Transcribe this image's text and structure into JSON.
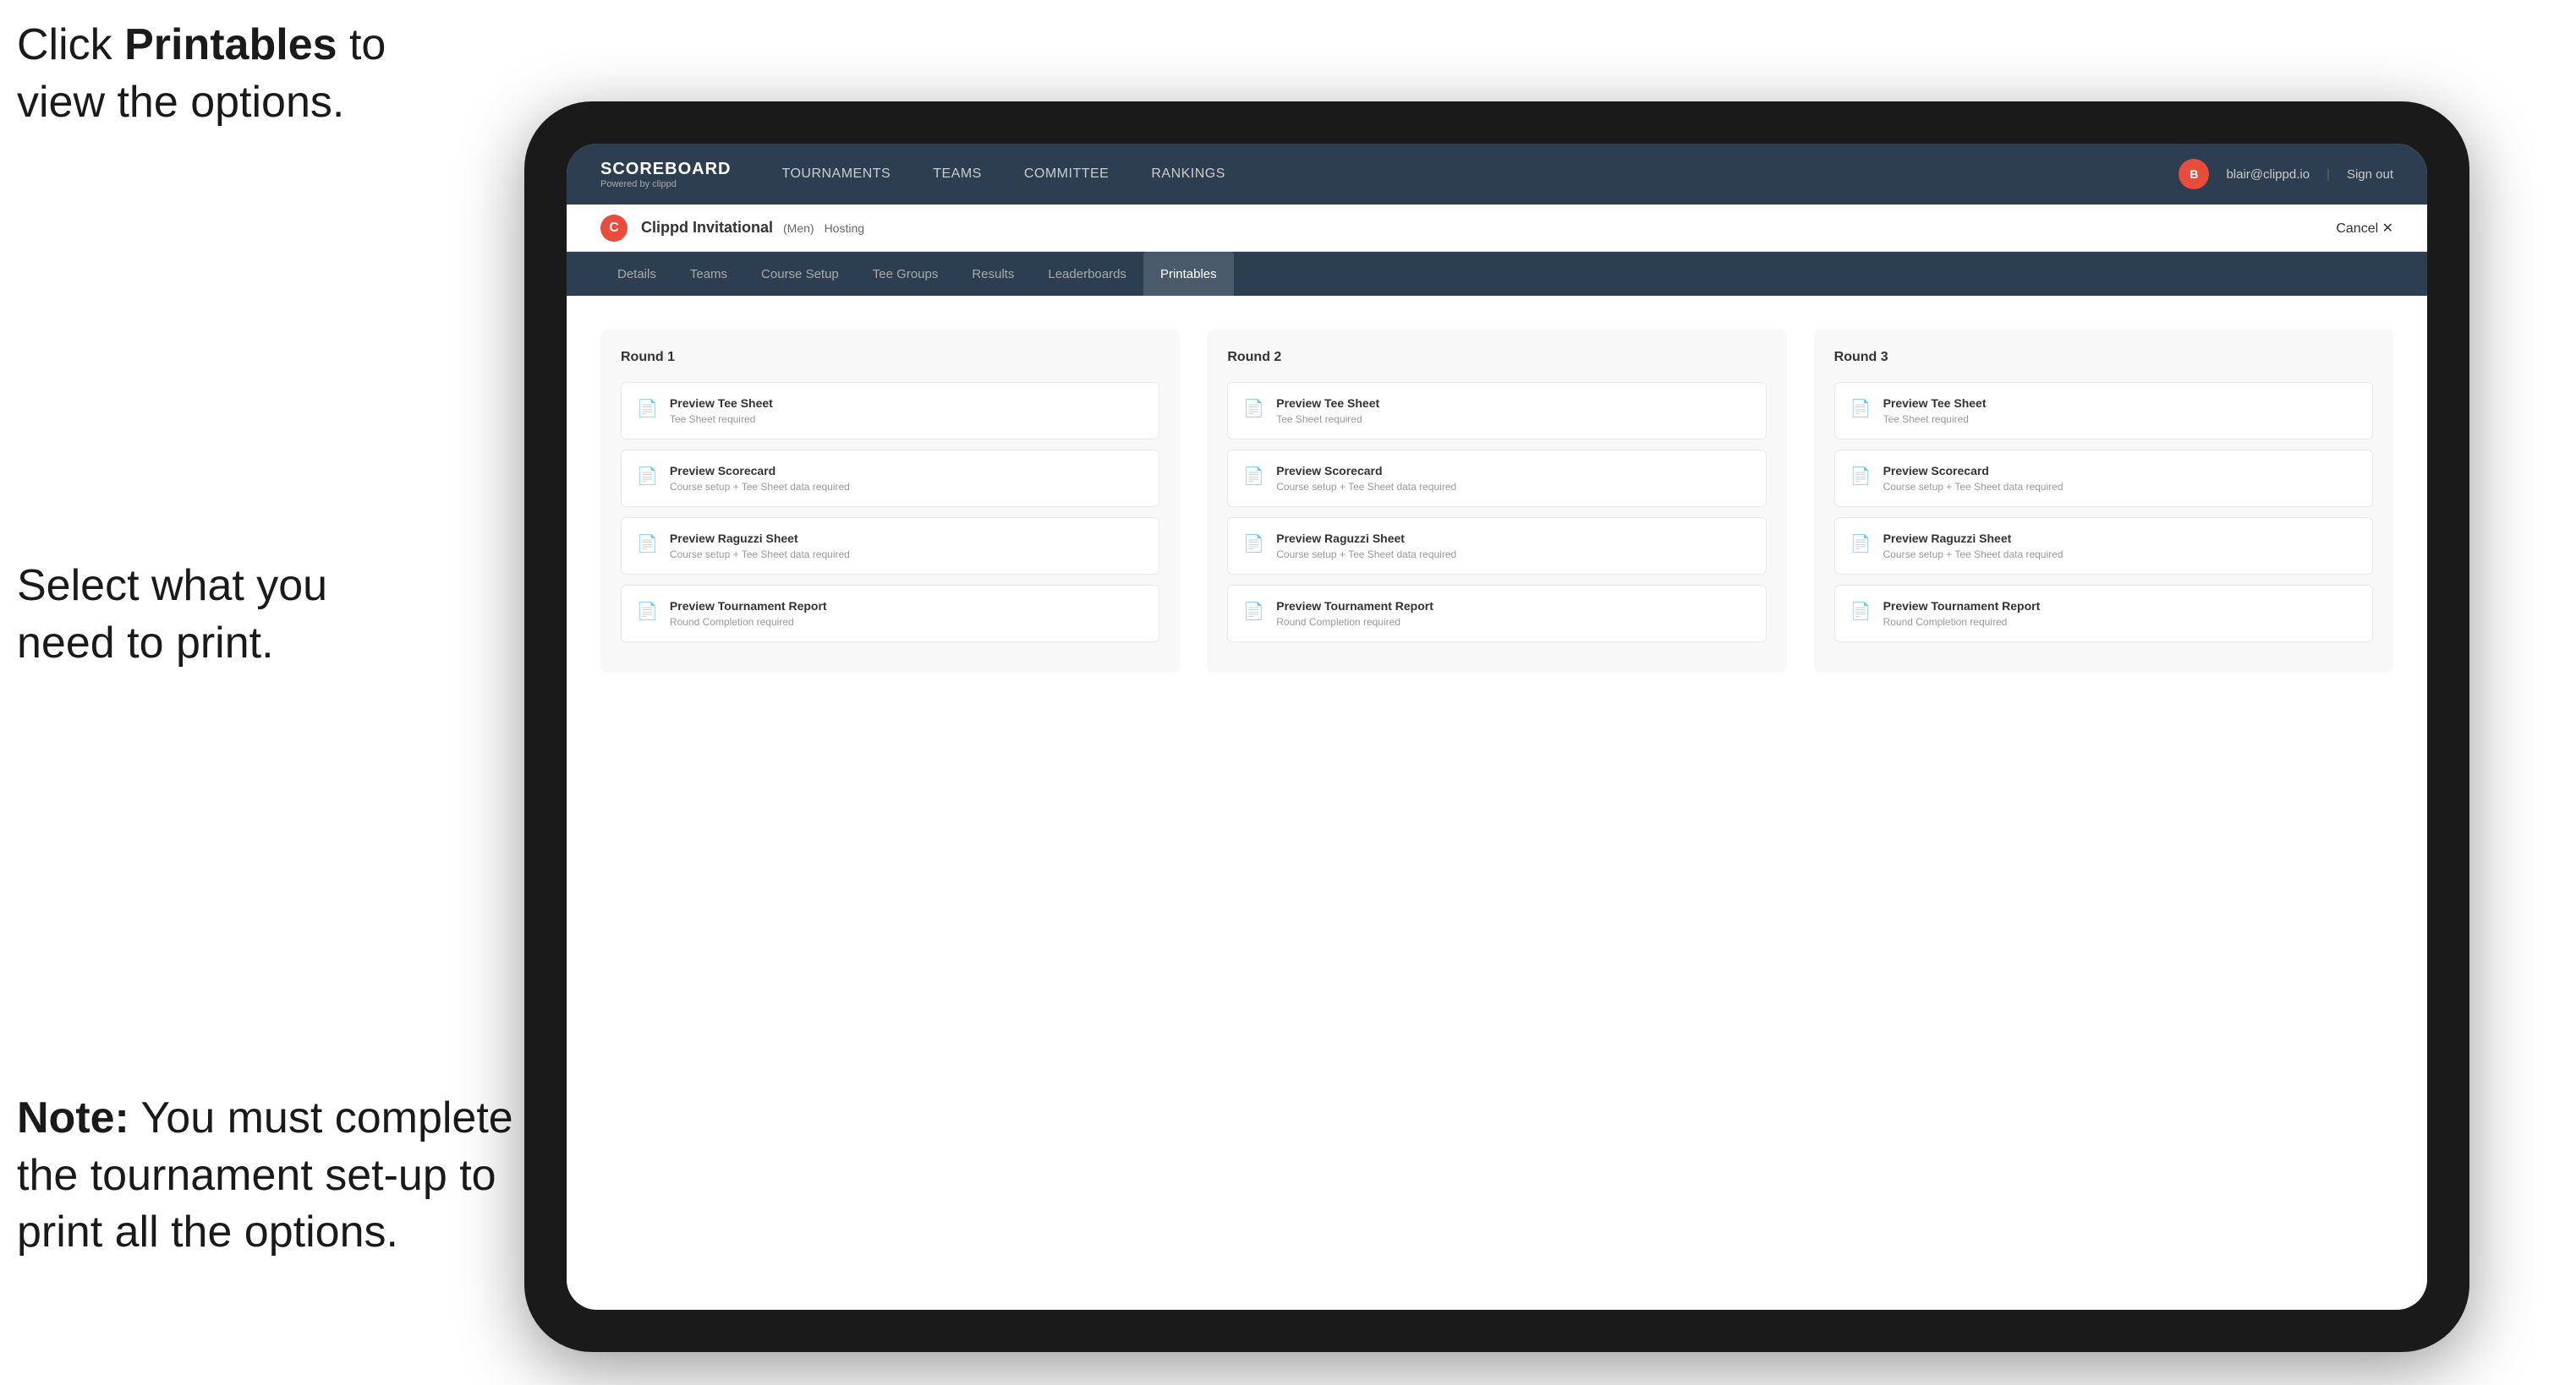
{
  "instructions": {
    "top_line1": "Click ",
    "top_bold": "Printables",
    "top_line2": " to",
    "top_line3": "view the options.",
    "middle": "Select what you\nneed to print.",
    "bottom_bold": "Note:",
    "bottom_text": " You must\ncomplete the\ntournament set-up\nto print all the options."
  },
  "header": {
    "brand_title": "SCOREBOARD",
    "brand_sub": "Powered by clippd",
    "nav_items": [
      {
        "label": "TOURNAMENTS",
        "active": false
      },
      {
        "label": "TEAMS",
        "active": false
      },
      {
        "label": "COMMITTEE",
        "active": false
      },
      {
        "label": "RANKINGS",
        "active": false
      }
    ],
    "user_email": "blair@clippd.io",
    "sign_out": "Sign out"
  },
  "tournament": {
    "logo_letter": "C",
    "name": "Clippd Invitational",
    "type": "(Men)",
    "status": "Hosting",
    "cancel": "Cancel ✕"
  },
  "tabs": [
    {
      "label": "Details",
      "active": false
    },
    {
      "label": "Teams",
      "active": false
    },
    {
      "label": "Course Setup",
      "active": false
    },
    {
      "label": "Tee Groups",
      "active": false
    },
    {
      "label": "Results",
      "active": false
    },
    {
      "label": "Leaderboards",
      "active": false
    },
    {
      "label": "Printables",
      "active": true
    }
  ],
  "rounds": [
    {
      "title": "Round 1",
      "items": [
        {
          "title": "Preview Tee Sheet",
          "subtitle": "Tee Sheet required"
        },
        {
          "title": "Preview Scorecard",
          "subtitle": "Course setup + Tee Sheet data required"
        },
        {
          "title": "Preview Raguzzi Sheet",
          "subtitle": "Course setup + Tee Sheet data required"
        },
        {
          "title": "Preview Tournament Report",
          "subtitle": "Round Completion required"
        }
      ]
    },
    {
      "title": "Round 2",
      "items": [
        {
          "title": "Preview Tee Sheet",
          "subtitle": "Tee Sheet required"
        },
        {
          "title": "Preview Scorecard",
          "subtitle": "Course setup + Tee Sheet data required"
        },
        {
          "title": "Preview Raguzzi Sheet",
          "subtitle": "Course setup + Tee Sheet data required"
        },
        {
          "title": "Preview Tournament Report",
          "subtitle": "Round Completion required"
        }
      ]
    },
    {
      "title": "Round 3",
      "items": [
        {
          "title": "Preview Tee Sheet",
          "subtitle": "Tee Sheet required"
        },
        {
          "title": "Preview Scorecard",
          "subtitle": "Course setup + Tee Sheet data required"
        },
        {
          "title": "Preview Raguzzi Sheet",
          "subtitle": "Course setup + Tee Sheet data required"
        },
        {
          "title": "Preview Tournament Report",
          "subtitle": "Round Completion required"
        }
      ]
    }
  ]
}
